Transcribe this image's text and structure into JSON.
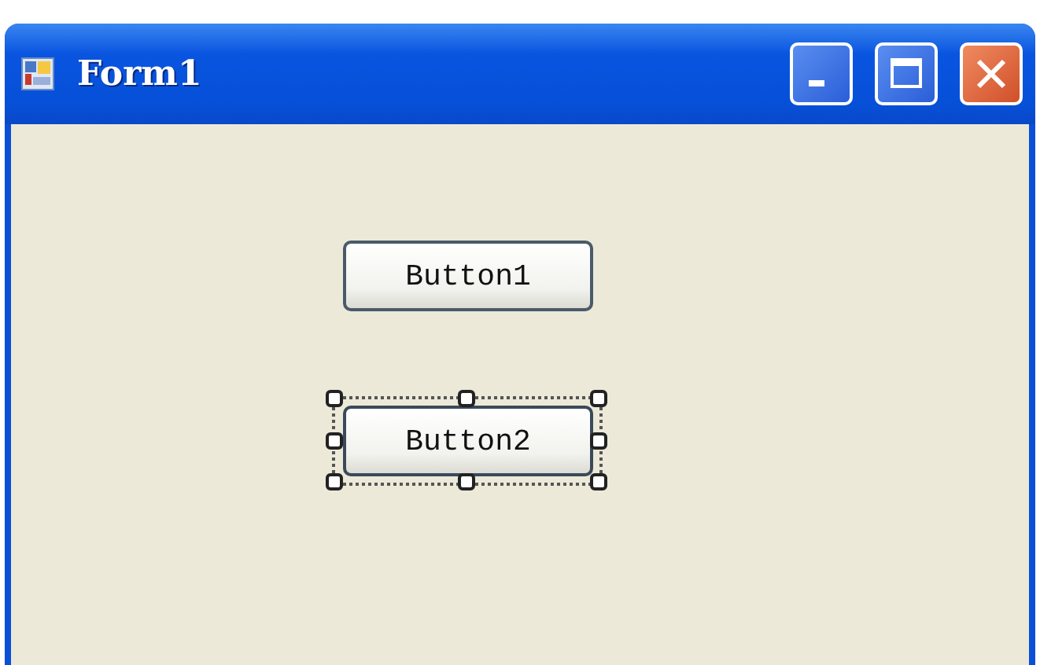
{
  "window": {
    "title": "Form1"
  },
  "buttons": [
    {
      "label": "Button1",
      "selected": false
    },
    {
      "label": "Button2",
      "selected": true
    }
  ]
}
